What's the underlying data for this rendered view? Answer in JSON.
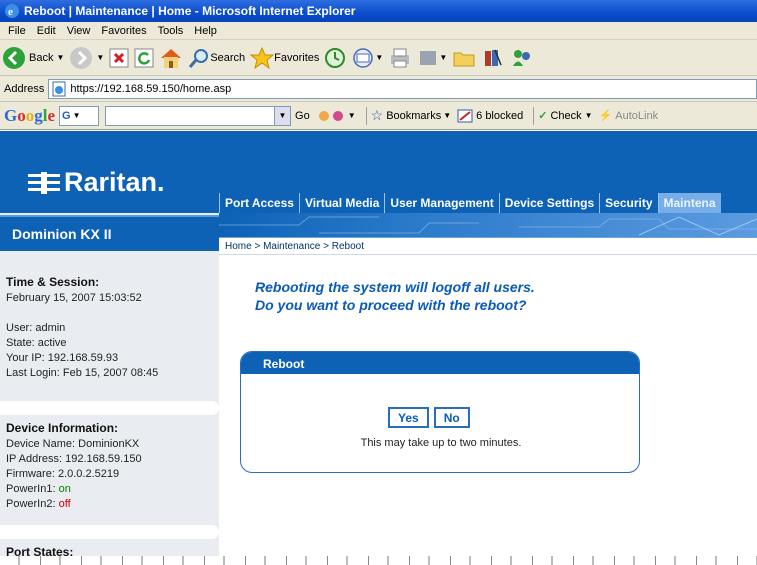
{
  "window": {
    "title": "Reboot | Maintenance | Home - Microsoft Internet Explorer"
  },
  "menu": {
    "items": [
      "File",
      "Edit",
      "View",
      "Favorites",
      "Tools",
      "Help"
    ]
  },
  "toolbar": {
    "back_label": "Back",
    "search_label": "Search",
    "favorites_label": "Favorites"
  },
  "address": {
    "label": "Address",
    "url": "https://192.168.59.150/home.asp"
  },
  "googlebar": {
    "logo": "Google",
    "g_label": "G",
    "go_label": "Go",
    "bookmarks_label": "Bookmarks",
    "blocked_label": "6 blocked",
    "check_label": "Check",
    "autolink_label": "AutoLink"
  },
  "brand": {
    "logo_text": "Raritan.",
    "product_name": "Dominion KX II"
  },
  "sidebar": {
    "time_session": {
      "heading": "Time & Session:",
      "date": "February 15, 2007 15:03:52",
      "user": "User: admin",
      "state": "State: active",
      "your_ip": "Your IP: 192.168.59.93",
      "last_login": "Last Login: Feb 15, 2007 08:45"
    },
    "device_info": {
      "heading": "Device Information:",
      "device_name": "Device Name: DominionKX",
      "ip_address": "IP Address: 192.168.59.150",
      "firmware": "Firmware: 2.0.0.2.5219",
      "powerin1_label": "PowerIn1: ",
      "powerin1_value": "on",
      "powerin2_label": "PowerIn2: ",
      "powerin2_value": "off"
    },
    "port_states": {
      "heading": "Port States:"
    }
  },
  "nav": {
    "items": [
      "Port Access",
      "Virtual Media",
      "User Management",
      "Device Settings",
      "Security",
      "Maintena"
    ]
  },
  "breadcrumb": "Home > Maintenance > Reboot",
  "message": {
    "line1": "Rebooting the system will logoff all users.",
    "line2": "Do you want to proceed with the reboot?"
  },
  "dialog": {
    "title": "Reboot",
    "yes_label": "Yes",
    "no_label": "No",
    "note": "This may take up to two minutes."
  },
  "colors": {
    "raritan_blue": "#0d62b6",
    "message_blue": "#0a5bb5",
    "power_on": "#008000",
    "power_off": "#d00000"
  }
}
